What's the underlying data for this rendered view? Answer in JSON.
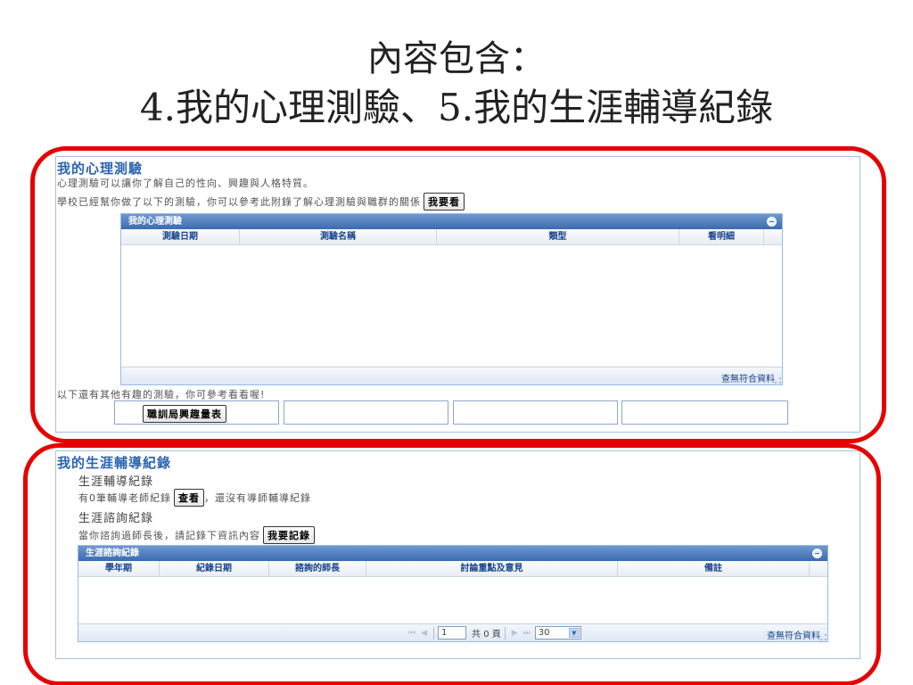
{
  "slide": {
    "title_line1": "內容包含：",
    "title_line2": "4.我的心理測驗、5.我的生涯輔導紀錄"
  },
  "psych": {
    "title": "我的心理測驗",
    "desc1": "心理測驗可以讓你了解自己的性向、興趣與人格特質。",
    "desc2": "學校已經幫你做了以下的測驗，你可以參考此附錄了解心理測驗與職群的關係",
    "look_button": "我要看",
    "grid_title": "我的心理測驗",
    "columns": [
      "測驗日期",
      "測驗名稱",
      "類型",
      "看明細"
    ],
    "no_data": "查無符合資料",
    "other_text": "以下還有其他有趣的測驗，你可參考看看喔!",
    "other_tests": [
      "職訓局興趣量表",
      "",
      "",
      ""
    ]
  },
  "career": {
    "title": "我的生涯輔導紀錄",
    "sub1": "生涯輔導紀錄",
    "line1_prefix": "有0筆輔導老師紀錄",
    "view_button": "查看",
    "line1_suffix": "，還沒有導師輔導紀錄",
    "sub2": "生涯諮詢紀錄",
    "line2_prefix": "當你諮詢過師長後，請記錄下資訊內容",
    "record_button": "我要記錄",
    "grid_title": "生涯諮詢紀錄",
    "columns": [
      "學年期",
      "紀錄日期",
      "諮詢的師長",
      "討論重點及意見",
      "備註"
    ],
    "pager": {
      "page": "1",
      "total": "共 0 頁",
      "page_size": "30"
    },
    "no_data": "查無符合資料"
  }
}
